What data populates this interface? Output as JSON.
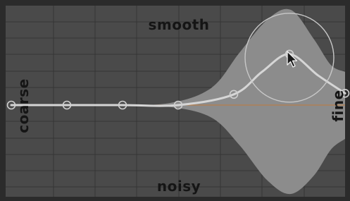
{
  "labels": {
    "top": "smooth",
    "bottom": "noisy",
    "left": "coarse",
    "right": "fine"
  },
  "colors": {
    "frame": "#2b2b2b",
    "background": "#4a4a4a",
    "grid": "#353535",
    "band": "#8c8c8c",
    "curve": "#d6d6d6",
    "baseline": "#c07a3a",
    "handle": "#cfcfcf"
  },
  "curve": {
    "node_count": 7,
    "selected_node": 5,
    "node_levels": [
      0,
      0,
      0,
      0,
      0.2,
      0.95,
      0.22
    ],
    "band_spread": [
      0,
      0,
      0,
      0.02,
      0.65,
      1.0,
      0.45
    ]
  },
  "cursor": {
    "icon": "arrow-cursor-icon"
  }
}
